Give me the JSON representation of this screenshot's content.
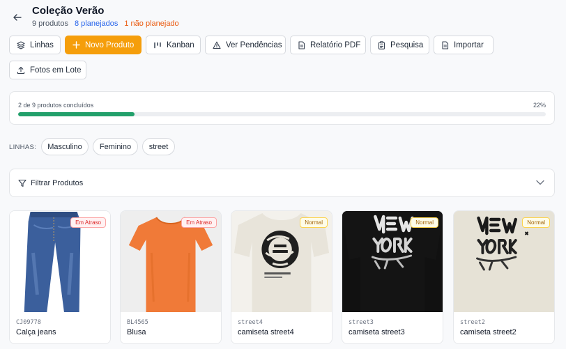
{
  "header": {
    "title": "Coleção Verão",
    "count": "9 produtos",
    "planned": "8 planejados",
    "unplanned": "1 não planejado"
  },
  "toolbar": {
    "lines": "Linhas",
    "new_product": "Novo Produto",
    "kanban": "Kanban",
    "pending": "Ver Pendências",
    "pdf_report": "Relatório PDF",
    "research": "Pesquisa",
    "import": "Importar",
    "batch_photos": "Fotos em Lote"
  },
  "progress": {
    "text": "2 de 9 produtos concluídos",
    "percent_label": "22%",
    "fraction": 0.22,
    "color": "#22a06b"
  },
  "lines": {
    "label": "LINHAS:",
    "items": [
      "Masculino",
      "Feminino",
      "street"
    ]
  },
  "filter": {
    "label": "Filtrar Produtos"
  },
  "products": [
    {
      "sku": "CJ09778",
      "name": "Calça jeans",
      "status": "Em Atraso",
      "image": "jeans"
    },
    {
      "sku": "BL4565",
      "name": "Blusa",
      "status": "Em Atraso",
      "image": "orange-tshirt"
    },
    {
      "sku": "street4",
      "name": "camiseta street4",
      "status": "Normal",
      "image": "cream-tshirt-graphic"
    },
    {
      "sku": "street3",
      "name": "camiseta street3",
      "status": "Normal",
      "image": "black-tshirt-graffiti"
    },
    {
      "sku": "street2",
      "name": "camiseta street2",
      "status": "Normal",
      "image": "cream-tshirt-graffiti"
    }
  ],
  "colors": {
    "accent": "#f59e0b",
    "planned": "#2563eb",
    "unplanned": "#ea580c",
    "late": "#dc2626",
    "normal": "#a16207"
  }
}
